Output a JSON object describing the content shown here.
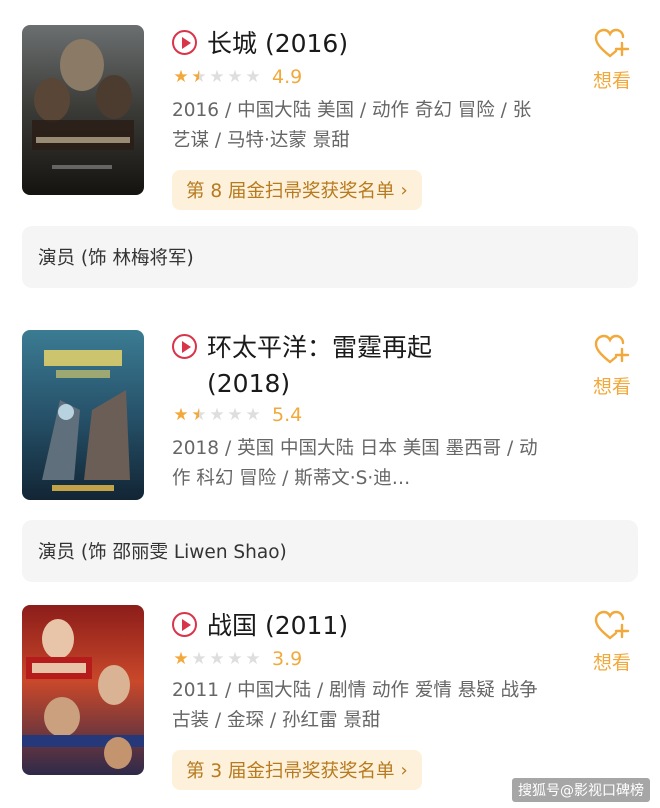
{
  "movies": [
    {
      "title": "长城 (2016)",
      "score": "4.9",
      "stars": [
        "full",
        "half",
        "empty",
        "empty",
        "empty"
      ],
      "meta": "2016 / 中国大陆 美国 / 动作 奇幻 冒险 / 张艺谋 / 马特·达蒙 景甜",
      "award": "第 8 届金扫帚奖获奖名单",
      "role": "演员 (饰 林梅将军)",
      "want_label": "想看"
    },
    {
      "title": "环太平洋：雷霆再起 (2018)",
      "score": "5.4",
      "stars": [
        "full",
        "half",
        "empty",
        "empty",
        "empty"
      ],
      "meta": "2018 / 英国 中国大陆 日本 美国 墨西哥 / 动作 科幻 冒险 / 斯蒂文·S·迪…",
      "role": "演员 (饰 邵丽雯 Liwen Shao)",
      "want_label": "想看"
    },
    {
      "title": "战国 (2011)",
      "score": "3.9",
      "stars": [
        "full",
        "empty",
        "empty",
        "empty",
        "empty"
      ],
      "meta": "2011 / 中国大陆 / 剧情 动作 爱情 悬疑 战争 古装 / 金琛 / 孙红雷 景甜",
      "award": "第 3 届金扫帚奖获奖名单",
      "want_label": "想看"
    }
  ],
  "award_chevron": "›",
  "icons": {
    "play": "play-circle-icon",
    "want": "heart-plus-icon",
    "star": "star-icon"
  },
  "colors": {
    "accent": "#f2a93b",
    "play_red": "#d9344a",
    "award_bg": "#fdf1dc",
    "award_text": "#b77a1e"
  },
  "watermark": "搜狐号@影视口碑榜"
}
